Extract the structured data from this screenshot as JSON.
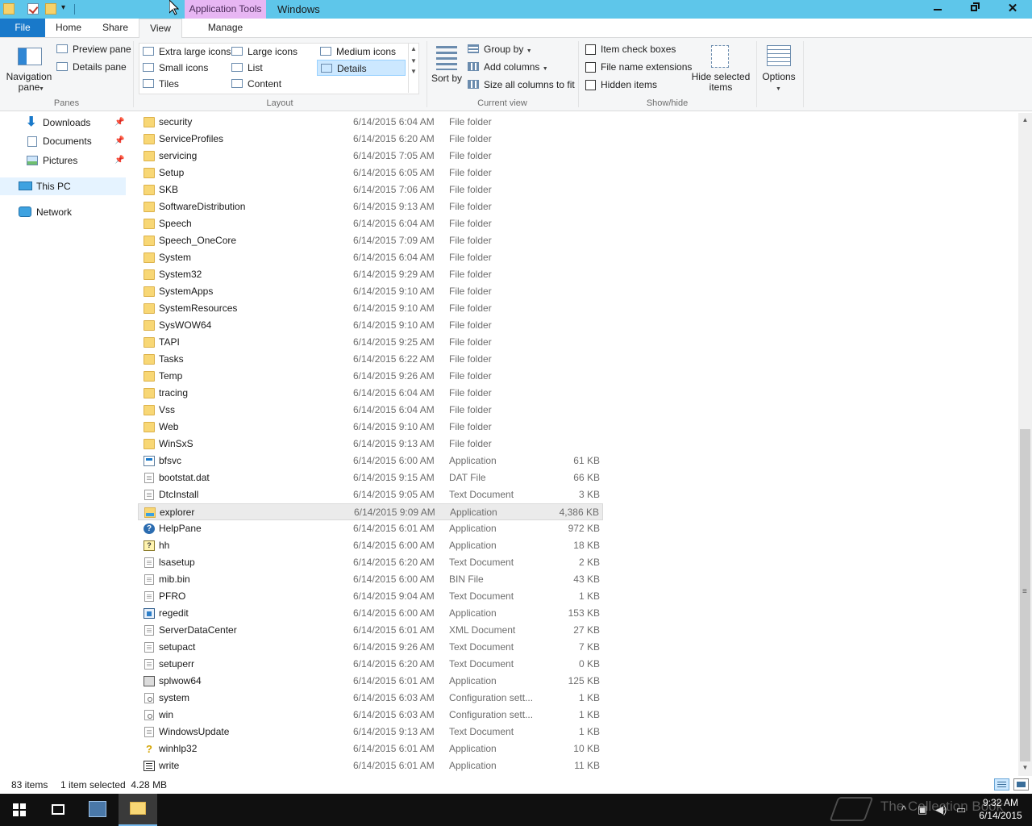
{
  "titlebar": {
    "contextual_tab": "Application Tools",
    "title": "Windows"
  },
  "tabs": {
    "file": "File",
    "home": "Home",
    "share": "Share",
    "view": "View",
    "manage": "Manage"
  },
  "ribbon": {
    "panes": {
      "navigation_pane": "Navigation pane",
      "preview_pane": "Preview pane",
      "details_pane": "Details pane",
      "label": "Panes"
    },
    "layout": {
      "extra_large_icons": "Extra large icons",
      "large_icons": "Large icons",
      "medium_icons": "Medium icons",
      "small_icons": "Small icons",
      "list": "List",
      "details": "Details",
      "tiles": "Tiles",
      "content": "Content",
      "label": "Layout",
      "selected": "Details"
    },
    "current_view": {
      "sort_by": "Sort by",
      "group_by": "Group by",
      "add_columns": "Add columns",
      "size_all_columns": "Size all columns to fit",
      "label": "Current view"
    },
    "show_hide": {
      "item_check_boxes": "Item check boxes",
      "file_name_extensions": "File name extensions",
      "hidden_items": "Hidden items",
      "hide_selected_items": "Hide selected items",
      "label": "Show/hide"
    },
    "options": "Options"
  },
  "nav": {
    "downloads": "Downloads",
    "documents": "Documents",
    "pictures": "Pictures",
    "this_pc": "This PC",
    "network": "Network"
  },
  "files": [
    {
      "name": "security",
      "date": "6/14/2015 6:04 AM",
      "type": "File folder",
      "size": "",
      "icon": "folder-icon"
    },
    {
      "name": "ServiceProfiles",
      "date": "6/14/2015 6:20 AM",
      "type": "File folder",
      "size": "",
      "icon": "folder-icon"
    },
    {
      "name": "servicing",
      "date": "6/14/2015 7:05 AM",
      "type": "File folder",
      "size": "",
      "icon": "folder-icon"
    },
    {
      "name": "Setup",
      "date": "6/14/2015 6:05 AM",
      "type": "File folder",
      "size": "",
      "icon": "folder-icon"
    },
    {
      "name": "SKB",
      "date": "6/14/2015 7:06 AM",
      "type": "File folder",
      "size": "",
      "icon": "folder-icon"
    },
    {
      "name": "SoftwareDistribution",
      "date": "6/14/2015 9:13 AM",
      "type": "File folder",
      "size": "",
      "icon": "folder-icon"
    },
    {
      "name": "Speech",
      "date": "6/14/2015 6:04 AM",
      "type": "File folder",
      "size": "",
      "icon": "folder-icon"
    },
    {
      "name": "Speech_OneCore",
      "date": "6/14/2015 7:09 AM",
      "type": "File folder",
      "size": "",
      "icon": "folder-icon"
    },
    {
      "name": "System",
      "date": "6/14/2015 6:04 AM",
      "type": "File folder",
      "size": "",
      "icon": "folder-icon"
    },
    {
      "name": "System32",
      "date": "6/14/2015 9:29 AM",
      "type": "File folder",
      "size": "",
      "icon": "folder-icon"
    },
    {
      "name": "SystemApps",
      "date": "6/14/2015 9:10 AM",
      "type": "File folder",
      "size": "",
      "icon": "folder-icon"
    },
    {
      "name": "SystemResources",
      "date": "6/14/2015 9:10 AM",
      "type": "File folder",
      "size": "",
      "icon": "folder-icon"
    },
    {
      "name": "SysWOW64",
      "date": "6/14/2015 9:10 AM",
      "type": "File folder",
      "size": "",
      "icon": "folder-icon"
    },
    {
      "name": "TAPI",
      "date": "6/14/2015 9:25 AM",
      "type": "File folder",
      "size": "",
      "icon": "folder-icon"
    },
    {
      "name": "Tasks",
      "date": "6/14/2015 6:22 AM",
      "type": "File folder",
      "size": "",
      "icon": "folder-icon"
    },
    {
      "name": "Temp",
      "date": "6/14/2015 9:26 AM",
      "type": "File folder",
      "size": "",
      "icon": "folder-icon"
    },
    {
      "name": "tracing",
      "date": "6/14/2015 6:04 AM",
      "type": "File folder",
      "size": "",
      "icon": "folder-icon"
    },
    {
      "name": "Vss",
      "date": "6/14/2015 6:04 AM",
      "type": "File folder",
      "size": "",
      "icon": "folder-icon"
    },
    {
      "name": "Web",
      "date": "6/14/2015 9:10 AM",
      "type": "File folder",
      "size": "",
      "icon": "folder-icon"
    },
    {
      "name": "WinSxS",
      "date": "6/14/2015 9:13 AM",
      "type": "File folder",
      "size": "",
      "icon": "folder-icon"
    },
    {
      "name": "bfsvc",
      "date": "6/14/2015 6:00 AM",
      "type": "Application",
      "size": "61 KB",
      "icon": "application-icon"
    },
    {
      "name": "bootstat.dat",
      "date": "6/14/2015 9:15 AM",
      "type": "DAT File",
      "size": "66 KB",
      "icon": "file-icon"
    },
    {
      "name": "DtcInstall",
      "date": "6/14/2015 9:05 AM",
      "type": "Text Document",
      "size": "3 KB",
      "icon": "text-document-icon"
    },
    {
      "name": "explorer",
      "date": "6/14/2015 9:09 AM",
      "type": "Application",
      "size": "4,386 KB",
      "icon": "explorer-icon",
      "selected": true
    },
    {
      "name": "HelpPane",
      "date": "6/14/2015 6:01 AM",
      "type": "Application",
      "size": "972 KB",
      "icon": "help-icon"
    },
    {
      "name": "hh",
      "date": "6/14/2015 6:00 AM",
      "type": "Application",
      "size": "18 KB",
      "icon": "html-help-icon"
    },
    {
      "name": "lsasetup",
      "date": "6/14/2015 6:20 AM",
      "type": "Text Document",
      "size": "2 KB",
      "icon": "text-document-icon"
    },
    {
      "name": "mib.bin",
      "date": "6/14/2015 6:00 AM",
      "type": "BIN File",
      "size": "43 KB",
      "icon": "file-icon"
    },
    {
      "name": "PFRO",
      "date": "6/14/2015 9:04 AM",
      "type": "Text Document",
      "size": "1 KB",
      "icon": "text-document-icon"
    },
    {
      "name": "regedit",
      "date": "6/14/2015 6:00 AM",
      "type": "Application",
      "size": "153 KB",
      "icon": "registry-icon"
    },
    {
      "name": "ServerDataCenter",
      "date": "6/14/2015 6:01 AM",
      "type": "XML Document",
      "size": "27 KB",
      "icon": "text-document-icon"
    },
    {
      "name": "setupact",
      "date": "6/14/2015 9:26 AM",
      "type": "Text Document",
      "size": "7 KB",
      "icon": "text-document-icon"
    },
    {
      "name": "setuperr",
      "date": "6/14/2015 6:20 AM",
      "type": "Text Document",
      "size": "0 KB",
      "icon": "text-document-icon"
    },
    {
      "name": "splwow64",
      "date": "6/14/2015 6:01 AM",
      "type": "Application",
      "size": "125 KB",
      "icon": "printer-icon"
    },
    {
      "name": "system",
      "date": "6/14/2015 6:03 AM",
      "type": "Configuration sett...",
      "size": "1 KB",
      "icon": "config-file-icon"
    },
    {
      "name": "win",
      "date": "6/14/2015 6:03 AM",
      "type": "Configuration sett...",
      "size": "1 KB",
      "icon": "config-file-icon"
    },
    {
      "name": "WindowsUpdate",
      "date": "6/14/2015 9:13 AM",
      "type": "Text Document",
      "size": "1 KB",
      "icon": "text-document-icon"
    },
    {
      "name": "winhlp32",
      "date": "6/14/2015 6:01 AM",
      "type": "Application",
      "size": "10 KB",
      "icon": "winhelp-icon"
    },
    {
      "name": "write",
      "date": "6/14/2015 6:01 AM",
      "type": "Application",
      "size": "11 KB",
      "icon": "wordpad-icon"
    }
  ],
  "status": {
    "item_count": "83 items",
    "selection": "1 item selected  4.28 MB"
  },
  "taskbar": {
    "watermark": "The Collection Book",
    "time": "9:32 AM",
    "date": "6/14/2015"
  },
  "colors": {
    "titlebar": "#5ec6ea",
    "contextual_tab": "#e7b6f3",
    "file_tab": "#1979ca",
    "selection": "#cce8ff",
    "taskbar": "#101010"
  }
}
